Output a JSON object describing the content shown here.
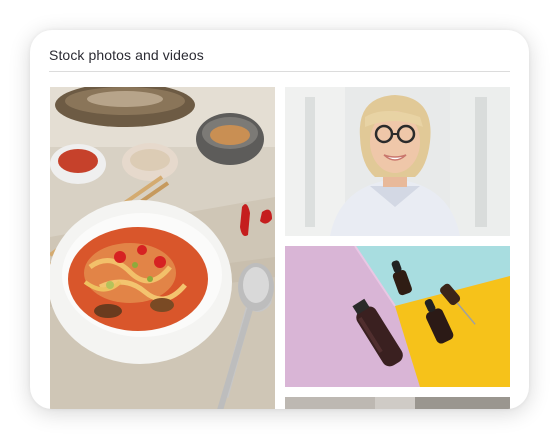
{
  "panel": {
    "title": "Stock photos and videos"
  },
  "gallery": {
    "items": [
      {
        "icon": "noodle-soup-bowl-photo",
        "subject": "bowl of spicy noodle soup with chopsticks and spoon"
      },
      {
        "icon": "smiling-woman-portrait-photo",
        "subject": "smiling blonde woman with glasses"
      },
      {
        "icon": "cosmetic-bottles-photo",
        "subject": "dark cosmetic bottles on pastel paper"
      },
      {
        "icon": "interior-photo",
        "subject": "partially visible photo"
      }
    ]
  },
  "colors": {
    "card_background": "#ffffff",
    "title_text": "#2b2b33",
    "divider": "#dcdcdc",
    "pastel_pink": "#d9b5d6",
    "pastel_blue": "#a8dde0",
    "pastel_yellow": "#f6c21a"
  }
}
